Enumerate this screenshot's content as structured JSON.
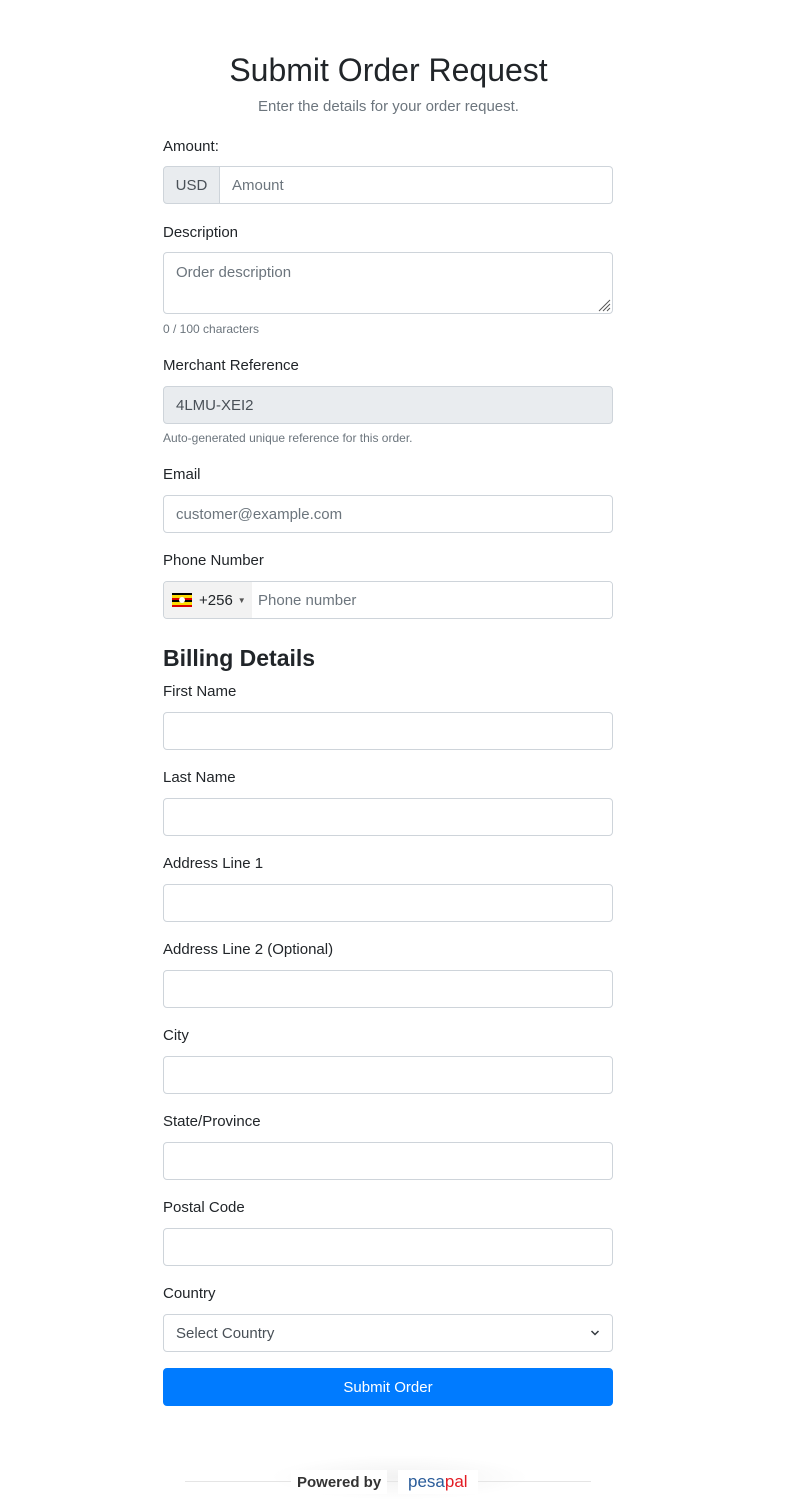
{
  "header": {
    "title": "Submit Order Request",
    "subtitle": "Enter the details for your order request."
  },
  "order": {
    "amount_label": "Amount:",
    "currency": "USD",
    "amount_placeholder": "Amount",
    "description_label": "Description",
    "description_placeholder": "Order description",
    "description_counter": "0 / 100 characters",
    "reference_label": "Merchant Reference",
    "reference_value": "4LMU-XEI2",
    "reference_help": "Auto-generated unique reference for this order.",
    "email_label": "Email",
    "email_placeholder": "customer@example.com",
    "phone_label": "Phone Number",
    "phone_dial_code": "+256",
    "phone_flag": "uganda-flag-icon",
    "phone_placeholder": "Phone number"
  },
  "billing": {
    "section_title": "Billing Details",
    "first_name_label": "First Name",
    "last_name_label": "Last Name",
    "address1_label": "Address Line 1",
    "address2_label": "Address Line 2 (Optional)",
    "city_label": "City",
    "state_label": "State/Province",
    "postal_label": "Postal Code",
    "country_label": "Country",
    "country_selected": "Select Country"
  },
  "actions": {
    "submit_label": "Submit Order"
  },
  "footer": {
    "powered_by": "Powered by",
    "brand_prefix": "pesa",
    "brand_suffix": "pal"
  },
  "colors": {
    "primary": "#007bff",
    "brand_blue": "#2a5c9a",
    "brand_red": "#e31b23"
  }
}
